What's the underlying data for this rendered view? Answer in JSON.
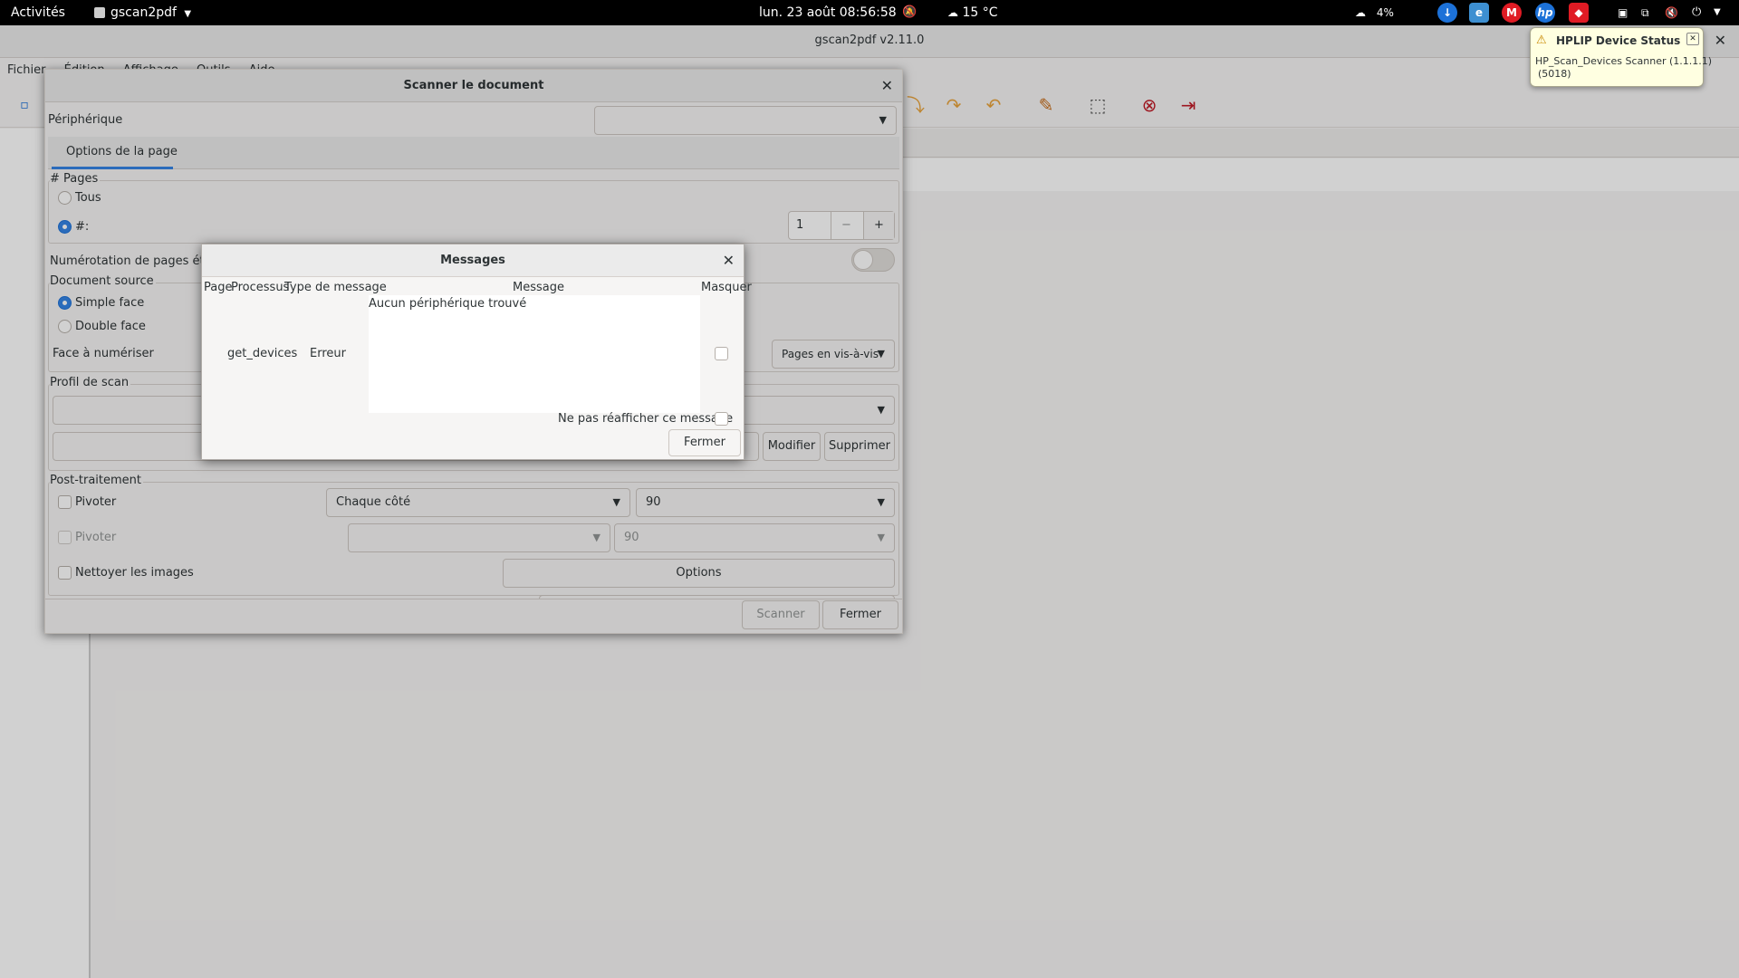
{
  "topbar": {
    "activities": "Activités",
    "app_name": "gscan2pdf",
    "clock": "lun. 23 août  08:56:58",
    "weather": "15 °C",
    "cpu": "4%"
  },
  "window": {
    "title": "gscan2pdf v2.11.0",
    "menu": [
      "Fichier",
      "Édition",
      "Affichage",
      "Outils",
      "Aide"
    ]
  },
  "scan_dialog": {
    "title": "Scanner le document",
    "device_label": "Périphérique",
    "tab": "Options de la page",
    "pages_section": "# Pages",
    "all_label": "Tous",
    "count_label": "#:",
    "count_value": "1",
    "extended_numbering": "Numérotation de pages étendue",
    "source_section": "Document source",
    "single_side": "Simple face",
    "double_side": "Double face",
    "side_to_scan": "Face à numériser",
    "side_value": "Pages en vis-à-vis",
    "profile_section": "Profil de scan",
    "modify_btn": "Modifier",
    "delete_btn": "Supprimer",
    "post_section": "Post-traitement",
    "rotate_label": "Pivoter",
    "rotate_label2": "Pivoter",
    "rotate_side": "Chaque côté",
    "rotate_angle": "90",
    "rotate_angle2": "90",
    "clean_label": "Nettoyer les images",
    "options_btn": "Options",
    "scan_btn": "Scanner",
    "close_btn": "Fermer"
  },
  "messages_dialog": {
    "title": "Messages",
    "columns": [
      "Page",
      "Processus",
      "Type de message",
      "Message",
      "Masquer"
    ],
    "row": {
      "process": "get_devices",
      "type": "Erreur",
      "message": "Aucun périphérique trouvé"
    },
    "dont_show": "Ne pas réafficher ce message",
    "close_btn": "Fermer"
  },
  "notification": {
    "title": "HPLIP Device Status",
    "body_line1": "HP_Scan_Devices Scanner (1.1.1.1)",
    "body_line2": "(5018)"
  },
  "colors": {
    "accent": "#3584e4",
    "tray_red": "#e01b24",
    "tray_blue": "#1c71d8"
  }
}
